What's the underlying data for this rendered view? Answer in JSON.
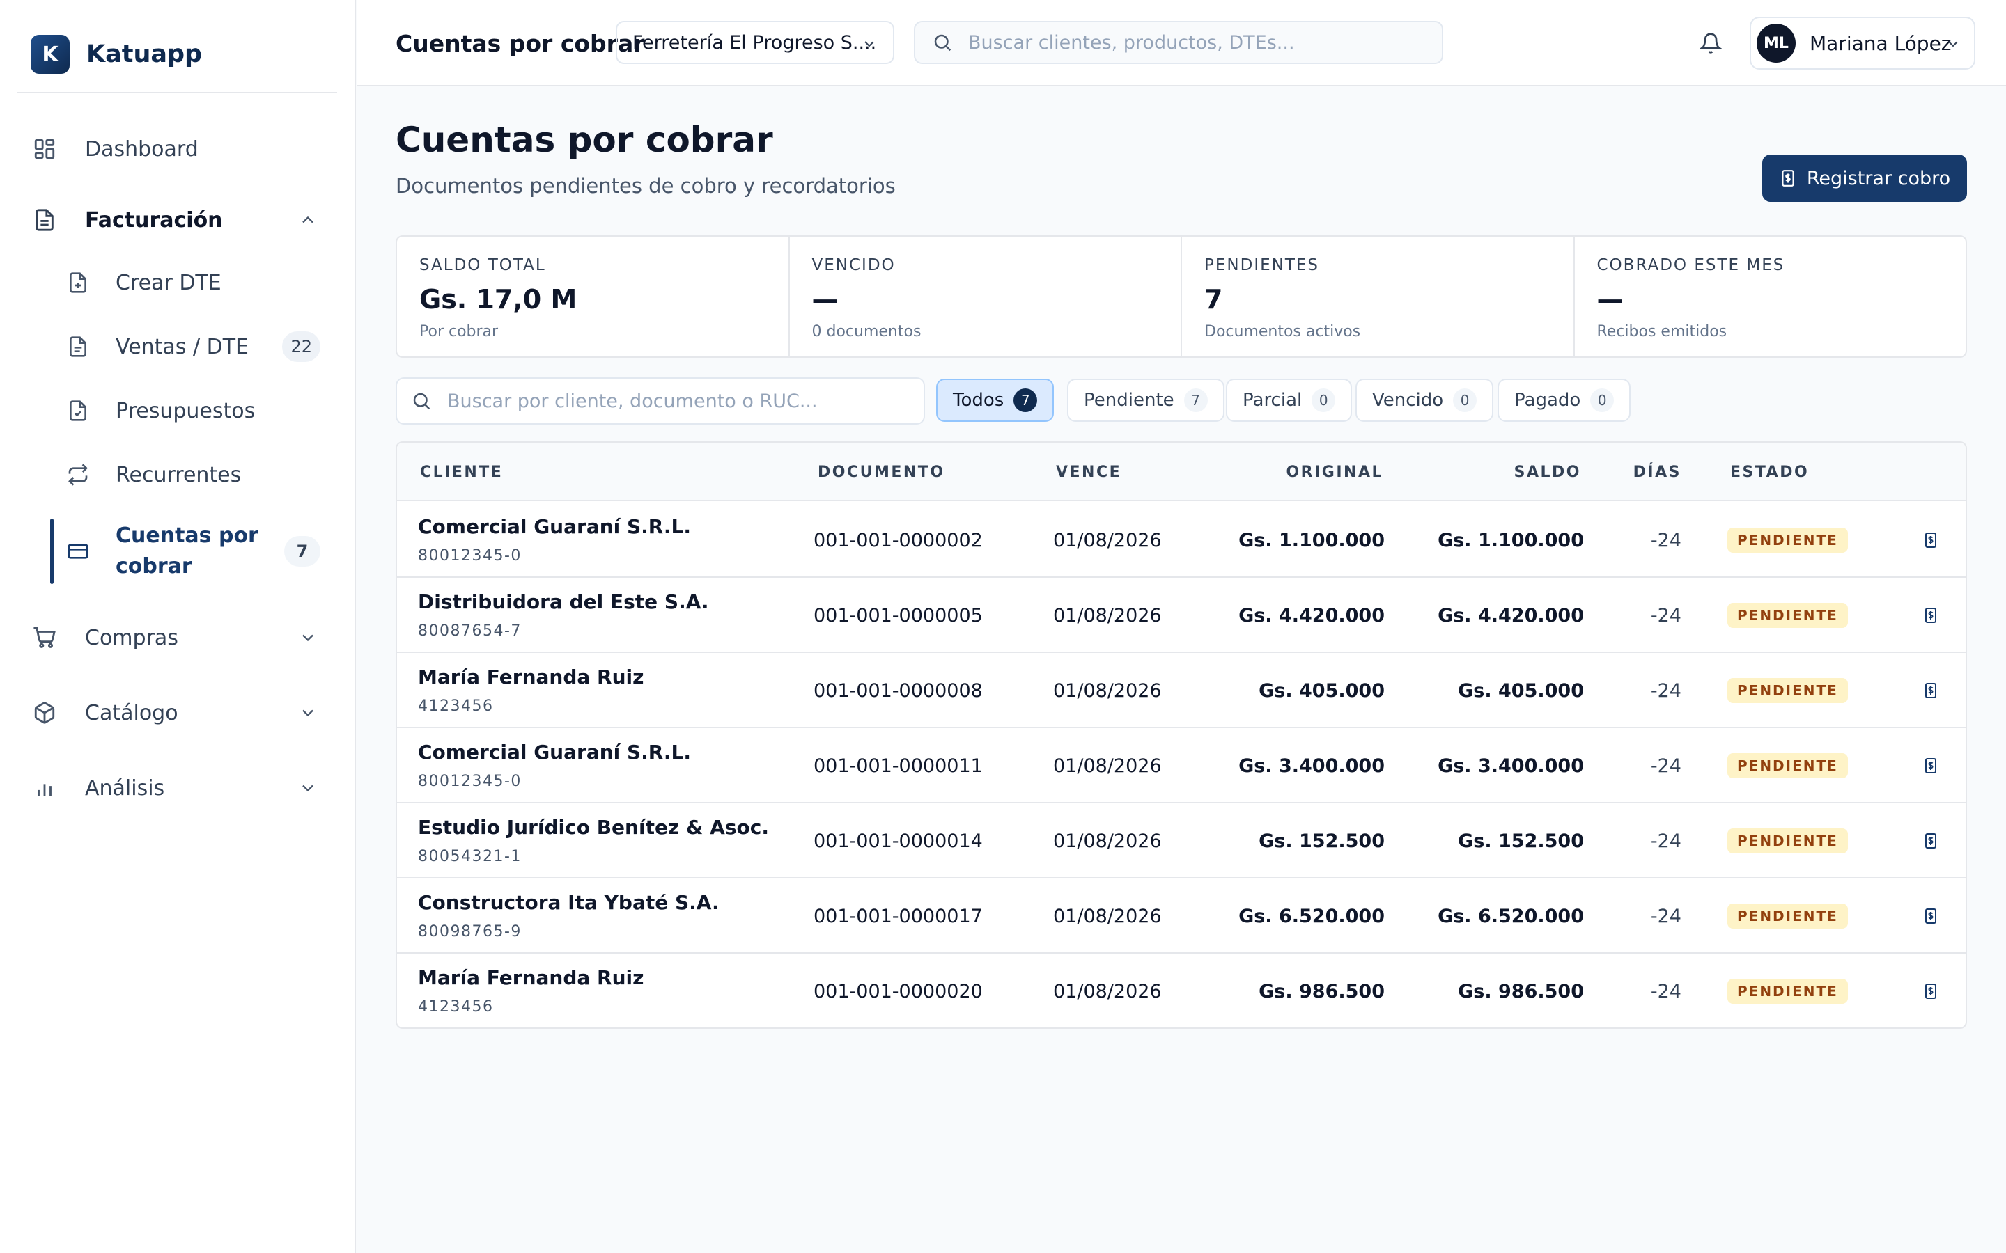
{
  "app": {
    "logo_letter": "K",
    "name": "Katuapp"
  },
  "sidebar": {
    "items": [
      {
        "label": "Dashboard",
        "icon": "dashboard-icon"
      },
      {
        "label": "Facturación",
        "icon": "document-icon",
        "expanded": true
      },
      {
        "label": "Compras",
        "icon": "cart-icon"
      },
      {
        "label": "Catálogo",
        "icon": "box-icon"
      },
      {
        "label": "Análisis",
        "icon": "bar-chart-icon"
      }
    ],
    "sub_items": [
      {
        "label": "Crear DTE",
        "icon": "file-plus-icon"
      },
      {
        "label": "Ventas / DTE",
        "icon": "file-text-icon",
        "count": "22"
      },
      {
        "label": "Presupuestos",
        "icon": "file-check-icon"
      },
      {
        "label": "Recurrentes",
        "icon": "repeat-icon"
      },
      {
        "label": "Cuentas por cobrar",
        "icon": "credit-card-icon",
        "count": "7",
        "active": true
      }
    ]
  },
  "topbar": {
    "title": "Cuentas por cobrar",
    "company": "Ferretería El Progreso S....",
    "search_placeholder": "Buscar clientes, productos, DTEs...",
    "user": {
      "initials": "ML",
      "name": "Mariana López"
    }
  },
  "page": {
    "title": "Cuentas por cobrar",
    "subtitle": "Documentos pendientes de cobro y recordatorios",
    "primary_button": "Registrar cobro"
  },
  "stats": [
    {
      "label": "SALDO TOTAL",
      "value": "Gs. 17,0 M",
      "note": "Por cobrar"
    },
    {
      "label": "VENCIDO",
      "value": "—",
      "note": "0 documentos"
    },
    {
      "label": "PENDIENTES",
      "value": "7",
      "note": "Documentos activos"
    },
    {
      "label": "COBRADO ESTE MES",
      "value": "—",
      "note": "Recibos emitidos"
    }
  ],
  "filters": {
    "search_placeholder": "Buscar por cliente, documento o RUC...",
    "chips": [
      {
        "label": "Todos",
        "count": "7",
        "active": true
      },
      {
        "label": "Pendiente",
        "count": "7"
      },
      {
        "label": "Parcial",
        "count": "0"
      },
      {
        "label": "Vencido",
        "count": "0"
      },
      {
        "label": "Pagado",
        "count": "0"
      }
    ]
  },
  "table": {
    "headers": {
      "client": "CLIENTE",
      "document": "DOCUMENTO",
      "due": "VENCE",
      "original": "ORIGINAL",
      "balance": "SALDO",
      "days": "DÍAS",
      "status": "ESTADO"
    },
    "rows": [
      {
        "client": "Comercial Guaraní S.R.L.",
        "ruc": "80012345-0",
        "document": "001-001-0000002",
        "due": "01/08/2026",
        "original": "Gs. 1.100.000",
        "balance": "Gs. 1.100.000",
        "days": "-24",
        "status": "PENDIENTE"
      },
      {
        "client": "Distribuidora del Este S.A.",
        "ruc": "80087654-7",
        "document": "001-001-0000005",
        "due": "01/08/2026",
        "original": "Gs. 4.420.000",
        "balance": "Gs. 4.420.000",
        "days": "-24",
        "status": "PENDIENTE"
      },
      {
        "client": "María Fernanda Ruiz",
        "ruc": "4123456",
        "document": "001-001-0000008",
        "due": "01/08/2026",
        "original": "Gs. 405.000",
        "balance": "Gs. 405.000",
        "days": "-24",
        "status": "PENDIENTE"
      },
      {
        "client": "Comercial Guaraní S.R.L.",
        "ruc": "80012345-0",
        "document": "001-001-0000011",
        "due": "01/08/2026",
        "original": "Gs. 3.400.000",
        "balance": "Gs. 3.400.000",
        "days": "-24",
        "status": "PENDIENTE"
      },
      {
        "client": "Estudio Jurídico Benítez & Asoc.",
        "ruc": "80054321-1",
        "document": "001-001-0000014",
        "due": "01/08/2026",
        "original": "Gs. 152.500",
        "balance": "Gs. 152.500",
        "days": "-24",
        "status": "PENDIENTE"
      },
      {
        "client": "Constructora Ita Ybaté S.A.",
        "ruc": "80098765-9",
        "document": "001-001-0000017",
        "due": "01/08/2026",
        "original": "Gs. 6.520.000",
        "balance": "Gs. 6.520.000",
        "days": "-24",
        "status": "PENDIENTE"
      },
      {
        "client": "María Fernanda Ruiz",
        "ruc": "4123456",
        "document": "001-001-0000020",
        "due": "01/08/2026",
        "original": "Gs. 986.500",
        "balance": "Gs. 986.500",
        "days": "-24",
        "status": "PENDIENTE"
      }
    ]
  },
  "colors": {
    "primary": "#173a6b",
    "badge_bg": "#fef3c7",
    "badge_text": "#92400e",
    "chip_active": "#dbeafe"
  }
}
